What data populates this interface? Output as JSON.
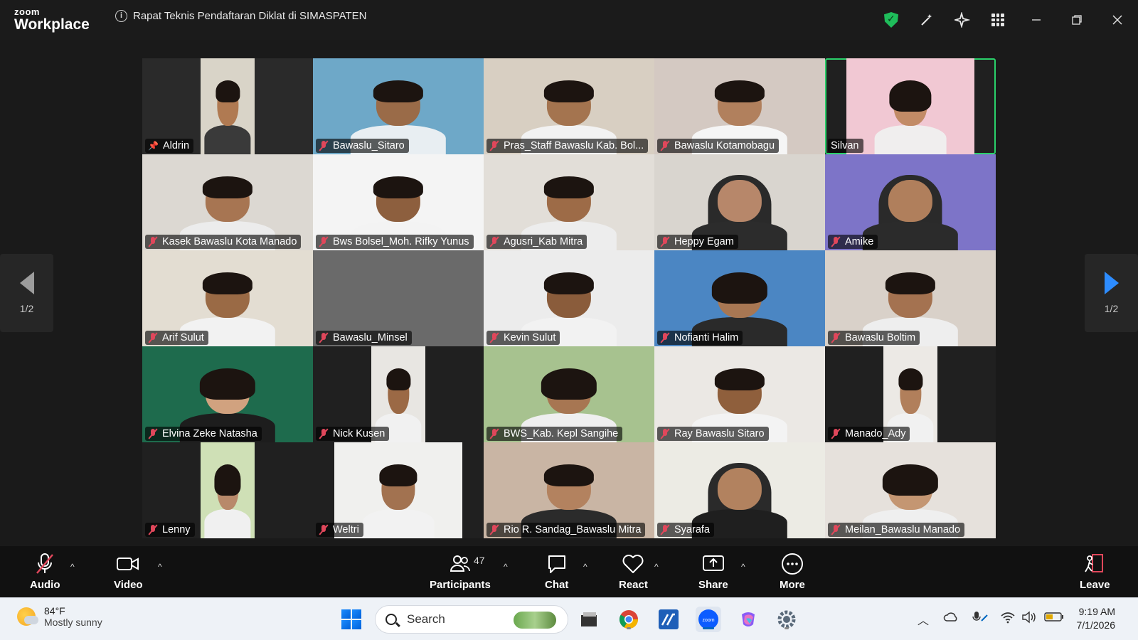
{
  "app": {
    "logo_small": "zoom",
    "logo_large": "Workplace",
    "meeting_title": "Rapat Teknis Pendaftaran Diklat di SIMASPATEN"
  },
  "title_icons": [
    "shield-icon",
    "magic-wand-icon",
    "sparkle-icon",
    "apps-grid-icon",
    "minimize-icon",
    "restore-icon",
    "close-icon"
  ],
  "page_indicator": {
    "left": "1/2",
    "right": "1/2"
  },
  "participants": [
    {
      "name": "Aldrin",
      "muted": false,
      "pinned": true,
      "bg": "#2a2a2a",
      "feed": "#d9d4c8",
      "fw": 0.32,
      "skin": "#b07a52",
      "shirt": "#3a3a3a",
      "look": "man"
    },
    {
      "name": "Bawaslu_Sitaro",
      "muted": true,
      "bg": "#4f94b8",
      "feed": "#6ea8c8",
      "fw": 1,
      "skin": "#9a6b48",
      "shirt": "#e8eef2",
      "look": "man"
    },
    {
      "name": "Pras_Staff Bawaslu Kab. Bol...",
      "muted": true,
      "bg": "#e8e4de",
      "feed": "#d8cfc2",
      "fw": 1,
      "skin": "#a4744f",
      "shirt": "#f2f2f2",
      "look": "group"
    },
    {
      "name": "Bawaslu Kotamobagu",
      "muted": true,
      "bg": "#e6e3e0",
      "feed": "#d4c9c2",
      "fw": 1,
      "skin": "#b1805d",
      "shirt": "#f5f5f5",
      "look": "group"
    },
    {
      "name": "Silvan",
      "muted": false,
      "bg": "#202020",
      "feed": "#f1c8d3",
      "fw": 0.75,
      "skin": "#c28b66",
      "shirt": "#f0eeee",
      "look": "woman",
      "active": true
    },
    {
      "name": "Kasek Bawaslu Kota Manado",
      "muted": true,
      "bg": "#e8e6e3",
      "feed": "#dcd8d2",
      "fw": 1,
      "skin": "#a77552",
      "shirt": "#ececec",
      "look": "man"
    },
    {
      "name": "Bws Bolsel_Moh. Rifky Yunus",
      "muted": true,
      "bg": "#fafafa",
      "feed": "#f4f4f4",
      "fw": 1,
      "skin": "#8d5f3e",
      "shirt": "#f3f3f3",
      "look": "man"
    },
    {
      "name": "Agusri_Kab Mitra",
      "muted": true,
      "bg": "#e9e7e3",
      "feed": "#e2ded8",
      "fw": 1,
      "skin": "#9d6b47",
      "shirt": "#ededed",
      "look": "man"
    },
    {
      "name": "Heppy Egam",
      "muted": true,
      "bg": "#e4e1dc",
      "feed": "#d9d5cf",
      "fw": 1,
      "skin": "#b7876a",
      "shirt": "#2c2c2c",
      "look": "hijab"
    },
    {
      "name": "Amike",
      "muted": true,
      "bg": "#6c63b8",
      "feed": "#7d74c8",
      "fw": 1,
      "skin": "#b07f5c",
      "shirt": "#2b2b2b",
      "look": "hijab"
    },
    {
      "name": "Arif Sulut",
      "muted": true,
      "bg": "#e9e6df",
      "feed": "#e3ddd2",
      "fw": 1,
      "skin": "#9a6a45",
      "shirt": "#f2f2f2",
      "look": "man"
    },
    {
      "name": "Bawaslu_Minsel",
      "muted": true,
      "bg": "#5f5f5f",
      "feed": "#6a6a6a",
      "fw": 1,
      "skin": "#6a6a6a",
      "shirt": "#6a6a6a",
      "look": "none"
    },
    {
      "name": "Kevin Sulut",
      "muted": true,
      "bg": "#e7e7e7",
      "feed": "#ececec",
      "fw": 1,
      "skin": "#8a5c3b",
      "shirt": "#f2f2f2",
      "look": "man"
    },
    {
      "name": "Nofianti Halim",
      "muted": true,
      "bg": "#2f6fb2",
      "feed": "#4b86c3",
      "fw": 1,
      "skin": "#a87753",
      "shirt": "#2a2a2a",
      "look": "woman"
    },
    {
      "name": "Bawaslu Boltim",
      "muted": true,
      "bg": "#e6e1dc",
      "feed": "#d9d1c9",
      "fw": 1,
      "skin": "#a47250",
      "shirt": "#eeeeee",
      "look": "group"
    },
    {
      "name": "Elvina Zeke Natasha",
      "muted": true,
      "bg": "#0f3a3a",
      "feed": "#1e6b4d",
      "fw": 1,
      "skin": "#d1a27f",
      "shirt": "#1d1d1d",
      "look": "woman"
    },
    {
      "name": "Nick Kusen",
      "muted": true,
      "bg": "#202020",
      "feed": "#e8e6e2",
      "fw": 0.32,
      "skin": "#9b6945",
      "shirt": "#f1f1f1",
      "look": "man"
    },
    {
      "name": "BWS_Kab. Kepl Sangihe",
      "muted": true,
      "bg": "#8eb07a",
      "feed": "#a7c28f",
      "fw": 1,
      "skin": "#a77652",
      "shirt": "#efefef",
      "look": "woman"
    },
    {
      "name": "Ray Bawaslu Sitaro",
      "muted": true,
      "bg": "#e8e6e3",
      "feed": "#ebe8e4",
      "fw": 1,
      "skin": "#8f5f3c",
      "shirt": "#f3f3f3",
      "look": "man"
    },
    {
      "name": "Manado_Ady",
      "muted": true,
      "bg": "#202020",
      "feed": "#ece9e5",
      "fw": 0.32,
      "skin": "#b17f5b",
      "shirt": "#f1f1f1",
      "look": "man"
    },
    {
      "name": "Lenny",
      "muted": true,
      "bg": "#202020",
      "feed": "#cfe0b6",
      "fw": 0.32,
      "skin": "#b8896a",
      "shirt": "#f0f0f0",
      "look": "woman"
    },
    {
      "name": "Weltri",
      "muted": true,
      "bg": "#202020",
      "feed": "#f0f0ee",
      "fw": 0.75,
      "skin": "#a27250",
      "shirt": "#f2f2f2",
      "look": "man"
    },
    {
      "name": "Rio R. Sandag_Bawaslu Mitra",
      "muted": true,
      "bg": "#d7c6b8",
      "feed": "#c9b5a4",
      "fw": 1,
      "skin": "#b3825f",
      "shirt": "#2b2b2b",
      "look": "man"
    },
    {
      "name": "Syarafa",
      "muted": true,
      "bg": "#efeee9",
      "feed": "#ecebe4",
      "fw": 1,
      "skin": "#b2825f",
      "shirt": "#1f1f1f",
      "look": "hijab"
    },
    {
      "name": "Meilan_Bawaslu Manado",
      "muted": true,
      "bg": "#eae7e3",
      "feed": "#e6e1dc",
      "fw": 1,
      "skin": "#c49672",
      "shirt": "#efefef",
      "look": "woman"
    }
  ],
  "toolbar": {
    "audio": "Audio",
    "video": "Video",
    "participants": "Participants",
    "participants_count": "47",
    "chat": "Chat",
    "react": "React",
    "share": "Share",
    "more": "More",
    "leave": "Leave"
  },
  "taskbar": {
    "temperature": "84°F",
    "weather": "Mostly sunny",
    "search_placeholder": "Search",
    "time": "9:19 AM",
    "date": "7/1/2026"
  },
  "colors": {
    "accent_blue": "#2d8cff",
    "active_border": "#2ad06a",
    "leave_red": "#e0475b",
    "muted_red": "#e0475b"
  }
}
